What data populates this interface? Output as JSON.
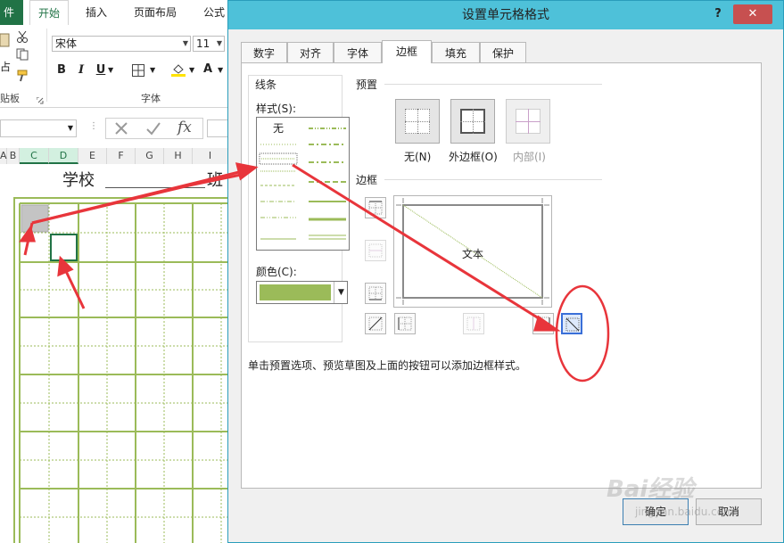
{
  "excel": {
    "file_tab": "件",
    "tabs": [
      "开始",
      "插入",
      "页面布局",
      "公式"
    ],
    "font_name": "宋体",
    "font_size": "11",
    "bold": "B",
    "italic": "I",
    "underline": "U",
    "group_font": "字体",
    "group_clipboard_partial": "贴板",
    "paste_partial": "占",
    "fx": "fx",
    "columns": [
      "A",
      "B",
      "C",
      "D",
      "E",
      "F",
      "G",
      "H",
      "I"
    ],
    "sheet_label_school": "学校",
    "sheet_label_class_partial": "班"
  },
  "dialog": {
    "title": "设置单元格格式",
    "help": "?",
    "close": "✕",
    "tabs": [
      "数字",
      "对齐",
      "字体",
      "边框",
      "填充",
      "保护"
    ],
    "active_tab": "边框",
    "line_group": "线条",
    "style_label": "样式(S):",
    "style_none": "无",
    "color_label": "颜色(C):",
    "line_color": "#9bbb59",
    "presets_label": "预置",
    "preset_none": "无(N)",
    "preset_outline": "外边框(O)",
    "preset_inside": "内部(I)",
    "border_label": "边框",
    "preview_text": "文本",
    "hint": "单击预置选项、预览草图及上面的按钮可以添加边框样式。",
    "ok": "确定",
    "cancel": "取消"
  },
  "watermark": {
    "text": "Bai经验",
    "url": "jingyan.baidu.com"
  },
  "annotation_color": "#e8353b"
}
